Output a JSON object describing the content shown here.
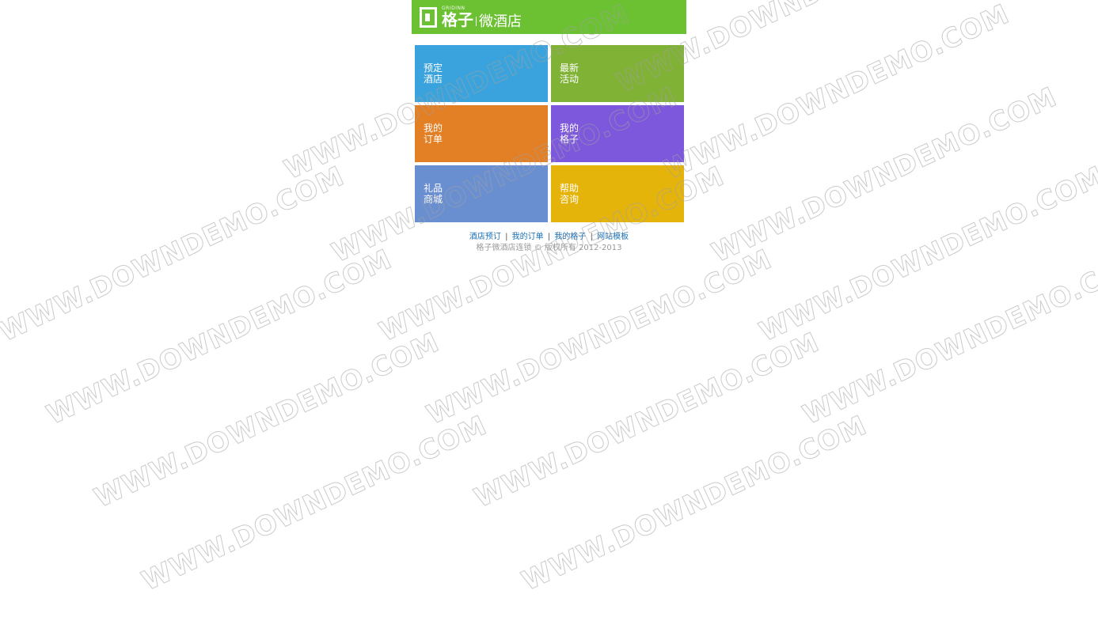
{
  "header": {
    "brand_en": "GRIDINN",
    "brand_cn": "格子",
    "brand_sub": "微酒店",
    "bg_color": "#6cc133"
  },
  "tiles": [
    {
      "line1": "预定",
      "line2": "酒店",
      "color": "#3aa3dd"
    },
    {
      "line1": "最新",
      "line2": "活动",
      "color": "#80b235"
    },
    {
      "line1": "我的",
      "line2": "订单",
      "color": "#e37f24"
    },
    {
      "line1": "我的",
      "line2": "格子",
      "color": "#7d58dc"
    },
    {
      "line1": "礼品",
      "line2": "商城",
      "color": "#6a8fd1"
    },
    {
      "line1": "帮助",
      "line2": "咨询",
      "color": "#e5b40b"
    }
  ],
  "footer": {
    "links": [
      "酒店预订",
      "我的订单",
      "我的格子",
      "网站模板"
    ],
    "separator": "|",
    "copyright": "格子微酒店连锁 © 版权所有 2012-2013"
  },
  "watermark": {
    "text": "WWW.DOWNDEMO.COM"
  }
}
